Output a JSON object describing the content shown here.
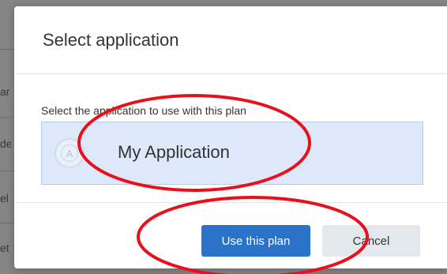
{
  "background_page": {
    "row_fragments": [
      "ar",
      "de",
      "el",
      "et"
    ]
  },
  "dialog": {
    "title": "Select application",
    "field_label": "Select the application to use with this plan",
    "application": {
      "icon": "app-circle-icon",
      "icon_glyph": "A",
      "name": "My Application",
      "selected": true
    },
    "buttons": {
      "primary_label": "Use this plan",
      "cancel_label": "Cancel"
    }
  },
  "annotations": {
    "color": "#e8101c",
    "highlighted": [
      "application option",
      "use this plan button"
    ]
  }
}
